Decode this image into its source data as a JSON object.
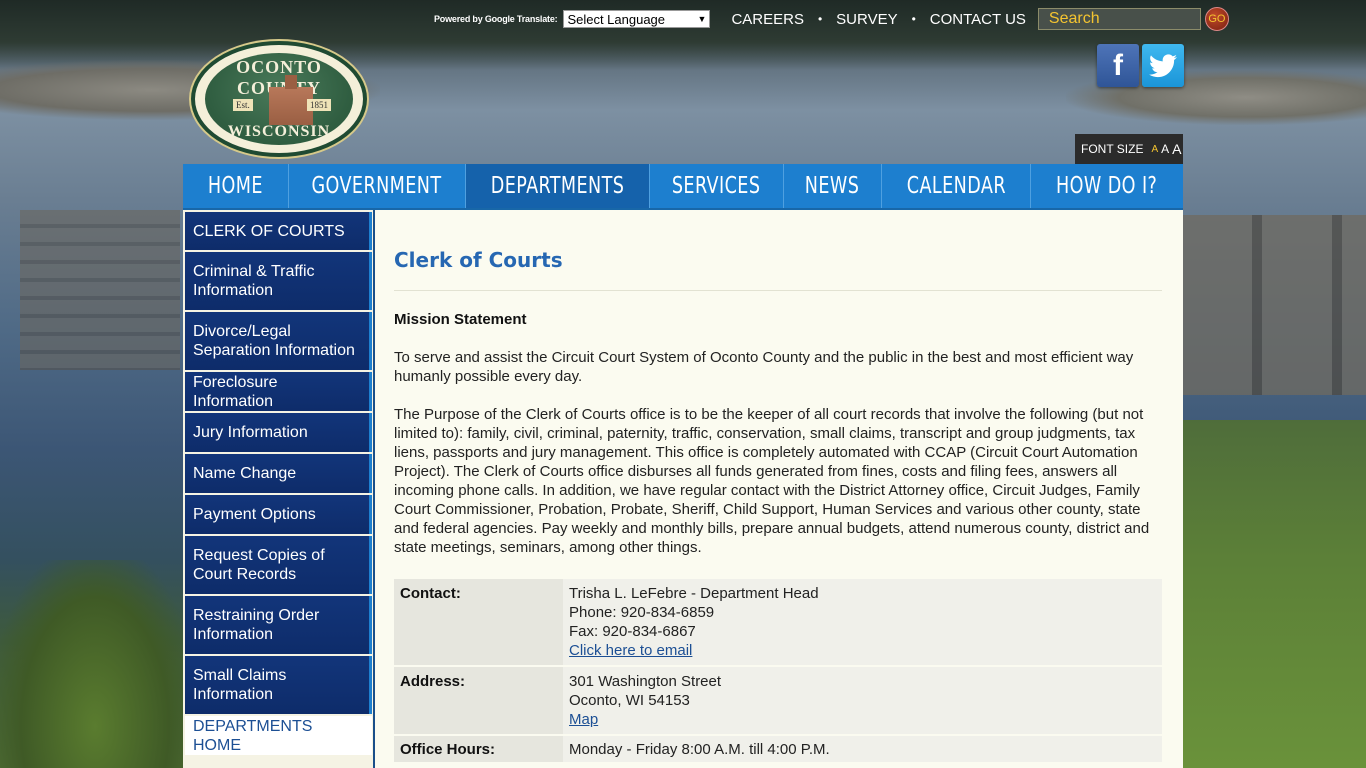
{
  "topbar": {
    "powered": "Powered by Google Translate:",
    "language_select": "Select Language",
    "links": [
      "CAREERS",
      "SURVEY",
      "CONTACT US"
    ],
    "search_placeholder": "Search",
    "go_label": "GO"
  },
  "logo": {
    "top": "OCONTO COUNTY",
    "bottom": "WISCONSIN",
    "est": "Est.",
    "year": "1851"
  },
  "social": {
    "facebook": "f",
    "twitter": "🐦"
  },
  "fontsize": {
    "label": "FONT SIZE",
    "small": "A",
    "medium": "A",
    "large": "A"
  },
  "nav": [
    {
      "label": "HOME"
    },
    {
      "label": "GOVERNMENT"
    },
    {
      "label": "DEPARTMENTS",
      "active": true
    },
    {
      "label": "SERVICES"
    },
    {
      "label": "NEWS"
    },
    {
      "label": "CALENDAR"
    },
    {
      "label": "HOW DO I?"
    }
  ],
  "sidebar": [
    {
      "label": "CLERK OF COURTS"
    },
    {
      "label": "Criminal & Traffic Information"
    },
    {
      "label": "Divorce/Legal Separation Information"
    },
    {
      "label": "Foreclosure Information"
    },
    {
      "label": "Jury Information"
    },
    {
      "label": "Name Change"
    },
    {
      "label": "Payment Options"
    },
    {
      "label": "Request Copies of Court Records"
    },
    {
      "label": "Restraining Order Information"
    },
    {
      "label": "Small Claims Information"
    },
    {
      "label": "DEPARTMENTS HOME"
    }
  ],
  "content": {
    "title": "Clerk of Courts",
    "mission_heading": "Mission Statement",
    "mission_text": "To serve and assist the Circuit Court System of Oconto County and the public in the best and most efficient way humanly possible every day.",
    "purpose_text": "The Purpose of the Clerk of Courts office is to be the keeper of all court records that involve the following (but not limited to): family, civil, criminal, paternity, traffic, conservation, small claims, transcript and group judgments, tax liens, passports and jury management. This office is completely automated with CCAP (Circuit Court Automation Project). The Clerk of Courts office disburses all funds generated from fines, costs and filing fees, answers all incoming phone calls. In addition, we have regular contact with the District Attorney office, Circuit Judges, Family Court Commissioner, Probation, Probate, Sheriff, Child Support, Human Services and various other county, state and federal agencies. Pay weekly and monthly bills, prepare annual budgets, attend numerous county, district and state meetings, seminars, among other things."
  },
  "info": {
    "contact_label": "Contact:",
    "contact_name": "Trisha L. LeFebre - Department Head",
    "contact_phone": "Phone: 920-834-6859",
    "contact_fax": "Fax: 920-834-6867",
    "contact_email_link": "Click here to email",
    "address_label": "Address:",
    "address_street": "301 Washington Street",
    "address_city": "Oconto, WI 54153",
    "address_map_link": "Map",
    "hours_label": "Office Hours:",
    "hours_value": "Monday - Friday 8:00 A.M. till 4:00 P.M."
  },
  "colors": {
    "nav_blue": "#1d7fcf",
    "nav_active": "#1562ab",
    "sidebar_navy": "#12357a",
    "title_blue": "#2667b2",
    "search_text": "#f4c430"
  }
}
